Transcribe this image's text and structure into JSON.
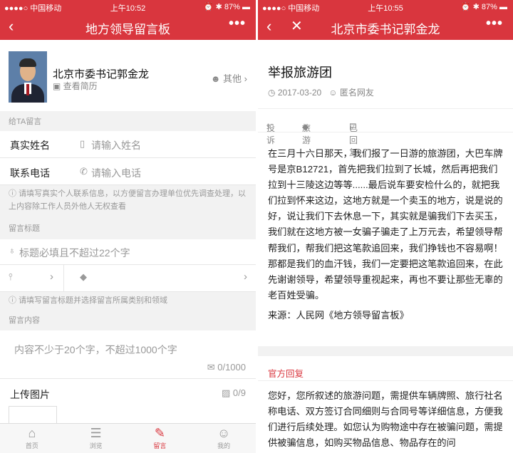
{
  "status": {
    "left": {
      "carrier": "●●●●○ 中国移动 ",
      "time": "上午10:52",
      "battery": "⏰ ✱ 87% ▬"
    },
    "right": {
      "carrier": "●●●●○ 中国移动 ",
      "time": "上午10:55",
      "battery": "⏰ ✱ 87% ▬"
    }
  },
  "left": {
    "nav_title": "地方领导留言板",
    "official_name": "北京市委书记郭金龙",
    "view_resume": "查看简历",
    "other": "其他",
    "section_give": "给TA留言",
    "name_label": "真实姓名",
    "name_placeholder": "请输入姓名",
    "phone_label": "联系电话",
    "phone_placeholder": "请输入电话",
    "privacy_hint": "请填写真实个人联系信息，以方便留言办理单位优先调查处理，以上内容除工作人员外他人无权查看",
    "section_title": "留言标题",
    "title_placeholder": "标题必填且不超过22个字",
    "category_hint": "请填写留言标题并选择留言所属类别和领域",
    "section_content": "留言内容",
    "content_placeholder": "内容不少于20个字，不超过1000个字",
    "counter": "0/1000",
    "upload_label": "上传图片",
    "upload_count": "0/9",
    "tabs": [
      {
        "label": "首页",
        "icon": "home-icon"
      },
      {
        "label": "浏览",
        "icon": "list-icon"
      },
      {
        "label": "留言",
        "icon": "edit-icon"
      },
      {
        "label": "我的",
        "icon": "user-icon"
      }
    ]
  },
  "right": {
    "nav_title": "北京市委书记郭金龙",
    "article_title": "举报旅游团",
    "date": "2017-03-20",
    "author": "匿名网友",
    "tag_type": "投诉",
    "tag_field": "旅游",
    "tag_status": "已回复",
    "body": "在三月十六日那天，我们报了一日游的旅游团，大巴车牌号是京B12721，首先把我们拉到了长城，然后再把我们拉到十三陵这边等等......最后说车要安检什么的，就把我们拉到怀来这边，这地方就是一个卖玉的地方，说是说的好，说让我们下去休息一下，其实就是骗我们下去买玉，我们就在这地方被一女骗子骗走了上万元去，希望领导帮帮我们，帮我们把这笔款追回来，我们挣钱也不容易啊！那都是我们的血汗钱，我们一定要把这笔款追回来，在此先谢谢领导，希望领导重视起来，再也不要让那些无辜的老百姓受骗。",
    "source": "来源：人民网《地方领导留言板》",
    "reply_label": "官方回复",
    "reply": "您好，您所叙述的旅游问题，需提供车辆牌照、旅行社名称电话、双方签订合同细则与合同号等详细信息，方便我们进行后续处理。如您认为购物途中存在被骗问题，需提供被骗信息，如购买物品信息、物品存在的问"
  },
  "colors": {
    "brand_red": "#d9363e",
    "bg_gray": "#f2f2f2"
  }
}
